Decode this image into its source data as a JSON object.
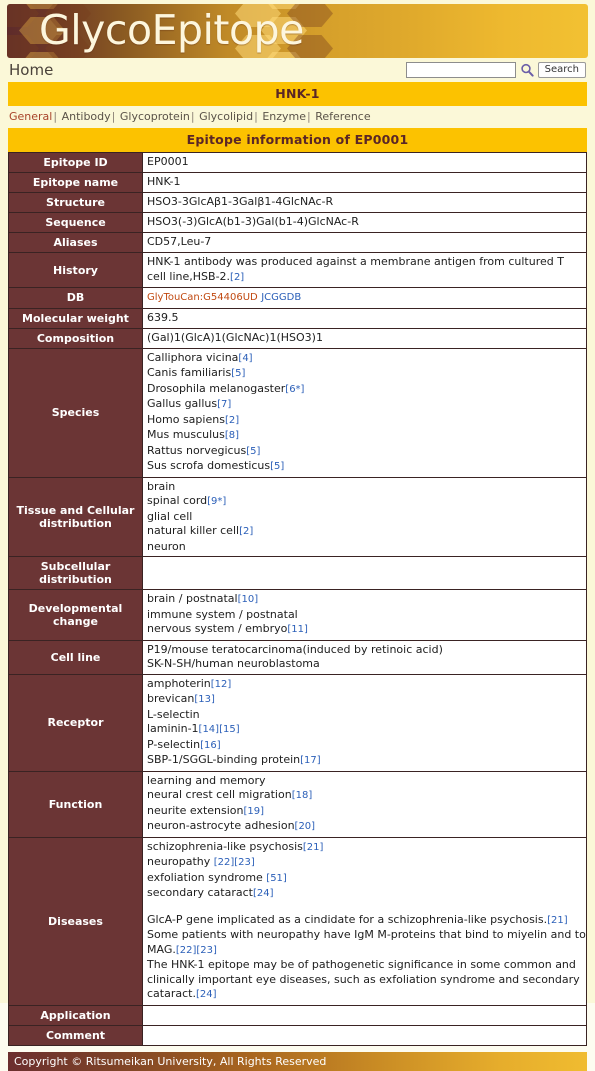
{
  "site": {
    "logo_text_part1": "Glyco",
    "logo_text_part2": "Epitope",
    "home_label": "Home",
    "footer": "Copyright © Ritsumeikan University, All Rights Reserved"
  },
  "search": {
    "value": "",
    "placeholder": "",
    "button_label": "Search",
    "icon": "search-icon"
  },
  "banners": {
    "epitope_name": "HNK-1",
    "section_title": "Epitope information of EP0001"
  },
  "nav": {
    "items": [
      {
        "label": "General",
        "active": true
      },
      {
        "label": "Antibody",
        "active": false
      },
      {
        "label": "Glycoprotein",
        "active": false
      },
      {
        "label": "Glycolipid",
        "active": false
      },
      {
        "label": "Enzyme",
        "active": false
      },
      {
        "label": "Reference",
        "active": false
      }
    ],
    "separator": "|"
  },
  "table": {
    "labels": {
      "epitope_id": "Epitope ID",
      "epitope_name": "Epitope name",
      "structure": "Structure",
      "sequence": "Sequence",
      "aliases": "Aliases",
      "history": "History",
      "db": "DB",
      "molecular_weight": "Molecular weight",
      "composition": "Composition",
      "species": "Species",
      "tissue": "Tissue and Cellular distribution",
      "subcellular": "Subcellular distribution",
      "developmental": "Developmental change",
      "cell_line": "Cell line",
      "receptor": "Receptor",
      "function": "Function",
      "diseases": "Diseases",
      "application": "Application",
      "comment": "Comment"
    },
    "values": {
      "epitope_id": "EP0001",
      "epitope_name": "HNK-1",
      "structure": "HSO3-3GlcAβ1-3Galβ1-4GlcNAc-R",
      "sequence": "HSO3(-3)GlcA(b1-3)Gal(b1-4)GlcNAc-R",
      "aliases": "CD57,Leu-7",
      "history_text": "HNK-1 antibody was produced against a membrane antigen from cultured T cell line,HSB-2.",
      "history_ref": "[2]",
      "db_glytoucan": "GlyTouCan:G54406UD",
      "db_jcggdb": "JCGGDB",
      "molecular_weight": "639.5",
      "composition": "(Gal)1(GlcA)1(GlcNAc)1(HSO3)1",
      "species": [
        {
          "text": "Calliphora vicina",
          "refs": "[4]"
        },
        {
          "text": "Canis familiaris",
          "refs": "[5]"
        },
        {
          "text": "Drosophila melanogaster",
          "refs": "[6*]"
        },
        {
          "text": "Gallus gallus",
          "refs": "[7]"
        },
        {
          "text": "Homo sapiens",
          "refs": "[2]"
        },
        {
          "text": "Mus musculus",
          "refs": "[8]"
        },
        {
          "text": "Rattus norvegicus",
          "refs": "[5]"
        },
        {
          "text": "Sus scrofa domesticus",
          "refs": "[5]"
        }
      ],
      "tissue": [
        {
          "text": "brain",
          "refs": ""
        },
        {
          "text": "spinal cord",
          "refs": "[9*]"
        },
        {
          "text": "glial cell",
          "refs": ""
        },
        {
          "text": "natural killer cell",
          "refs": "[2]"
        },
        {
          "text": "neuron",
          "refs": ""
        }
      ],
      "subcellular": "",
      "developmental": [
        {
          "text": "brain / postnatal",
          "refs": "[10]"
        },
        {
          "text": "immune system / postnatal",
          "refs": ""
        },
        {
          "text": "nervous system / embryo",
          "refs": "[11]"
        }
      ],
      "cell_line": [
        {
          "text": "P19/mouse teratocarcinoma(induced by retinoic acid)",
          "refs": ""
        },
        {
          "text": "SK-N-SH/human neuroblastoma",
          "refs": ""
        }
      ],
      "receptor": [
        {
          "text": "amphoterin",
          "refs": "[12]"
        },
        {
          "text": "brevican",
          "refs": "[13]"
        },
        {
          "text": "L-selectin",
          "refs": ""
        },
        {
          "text": "laminin-1",
          "refs": "[14][15]"
        },
        {
          "text": "P-selectin",
          "refs": "[16]"
        },
        {
          "text": "SBP-1/SGGL-binding protein",
          "refs": "[17]"
        }
      ],
      "function": [
        {
          "text": "learning and memory",
          "refs": ""
        },
        {
          "text": "neural crest cell migration",
          "refs": "[18]"
        },
        {
          "text": "neurite extension",
          "refs": "[19]"
        },
        {
          "text": "neuron-astrocyte adhesion",
          "refs": "[20]"
        }
      ],
      "diseases_list": [
        {
          "text": "schizophrenia-like psychosis",
          "refs": "[21]"
        },
        {
          "text": "neuropathy ",
          "refs": "[22][23]"
        },
        {
          "text": "exfoliation syndrome ",
          "refs": "[51]"
        },
        {
          "text": "secondary cataract",
          "refs": "[24]"
        }
      ],
      "diseases_notes": [
        {
          "text": "GlcA-P gene implicated as a cindidate for a schizophrenia-like psychosis.",
          "refs": "[21]"
        },
        {
          "text": "Some patients with neuropathy have IgM M-proteins that bind to miyelin and to MAG.",
          "refs": "[22][23]"
        },
        {
          "text": "The HNK-1 epitope may be of pathogenetic significance in some common and clinically important eye diseases, such as exfoliation syndrome and secondary cataract.",
          "refs": "[24]"
        }
      ],
      "application": "",
      "comment": ""
    }
  },
  "colors": {
    "gold": "#fcc200",
    "maroon": "#6b3535",
    "page_bg": "#fbf8d8",
    "link_blue": "#2b5fb8",
    "link_orange": "#c14a12",
    "nav_active": "#a8442a"
  }
}
